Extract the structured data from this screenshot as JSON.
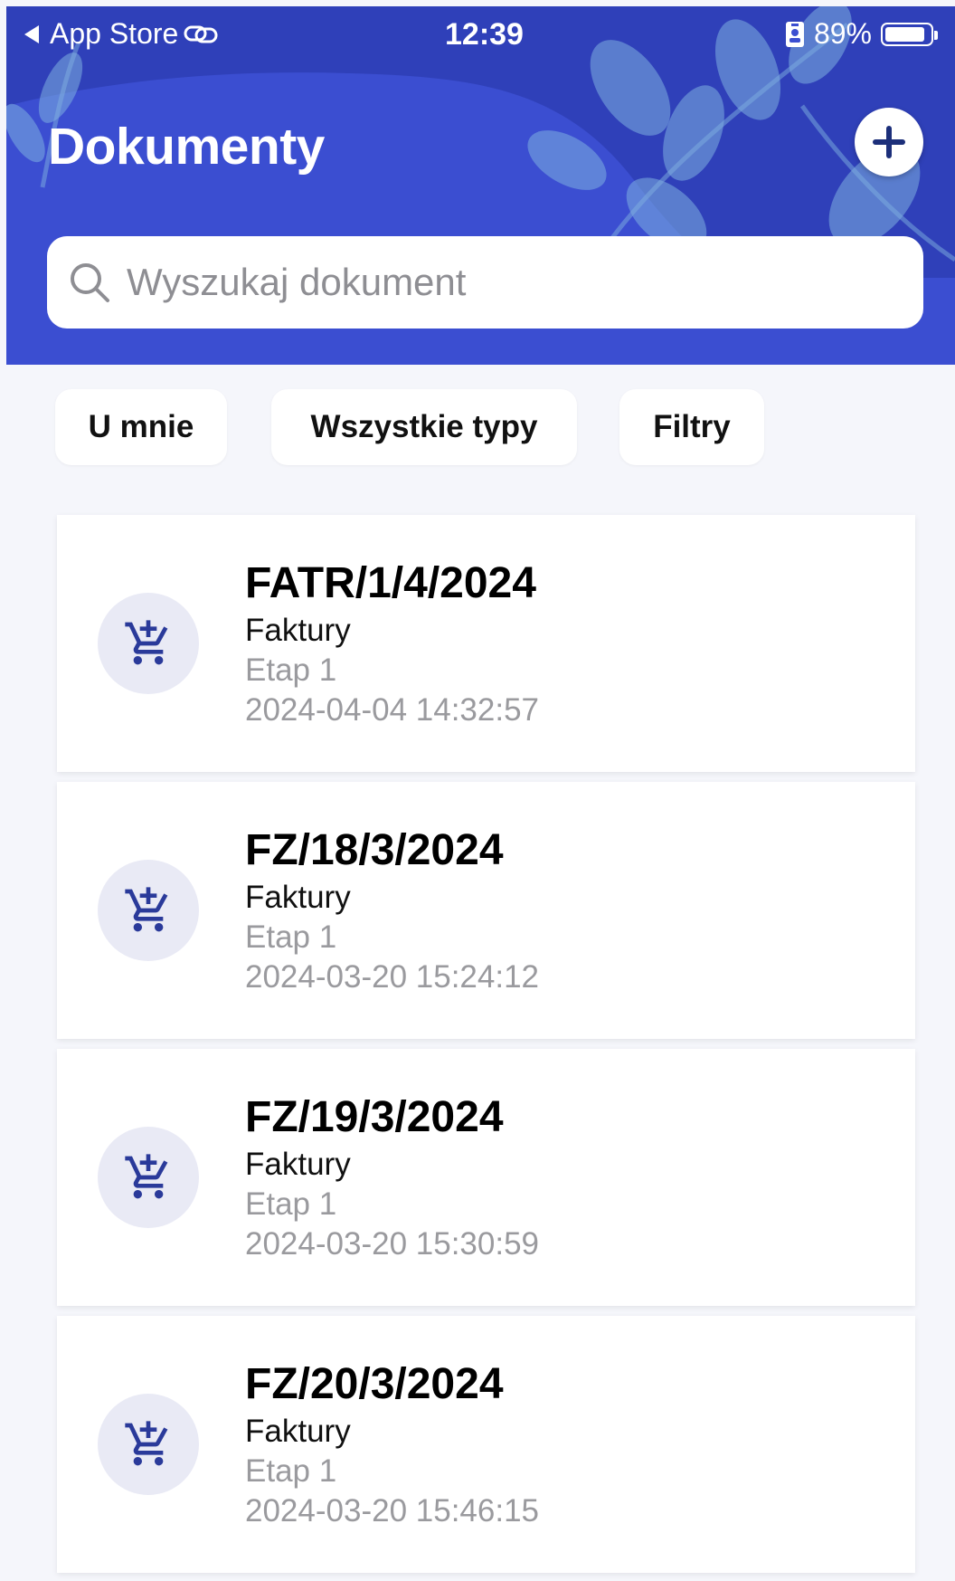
{
  "statusbar": {
    "back_label": "App Store",
    "time": "12:39",
    "battery_percent": "89%",
    "battery_level": 0.89
  },
  "header": {
    "title": "Dokumenty",
    "add_icon": "plus-icon"
  },
  "search": {
    "placeholder": "Wyszukaj dokument",
    "value": ""
  },
  "filters": [
    {
      "label": "U mnie"
    },
    {
      "label": "Wszystkie typy"
    },
    {
      "label": "Filtry"
    }
  ],
  "documents": [
    {
      "code": "FATR/1/4/2024",
      "type": "Faktury",
      "stage": "Etap 1",
      "date": "2024-04-04 14:32:57",
      "icon": "cart-add-icon"
    },
    {
      "code": "FZ/18/3/2024",
      "type": "Faktury",
      "stage": "Etap 1",
      "date": "2024-03-20 15:24:12",
      "icon": "cart-add-icon"
    },
    {
      "code": "FZ/19/3/2024",
      "type": "Faktury",
      "stage": "Etap 1",
      "date": "2024-03-20 15:30:59",
      "icon": "cart-add-icon"
    },
    {
      "code": "FZ/20/3/2024",
      "type": "Faktury",
      "stage": "Etap 1",
      "date": "2024-03-20 15:46:15",
      "icon": "cart-add-icon"
    }
  ],
  "colors": {
    "header_bg": "#3b4ed1",
    "accent": "#1c2f7a",
    "icon_bg": "#e9eaf5",
    "page_bg": "#f5f6fb"
  }
}
